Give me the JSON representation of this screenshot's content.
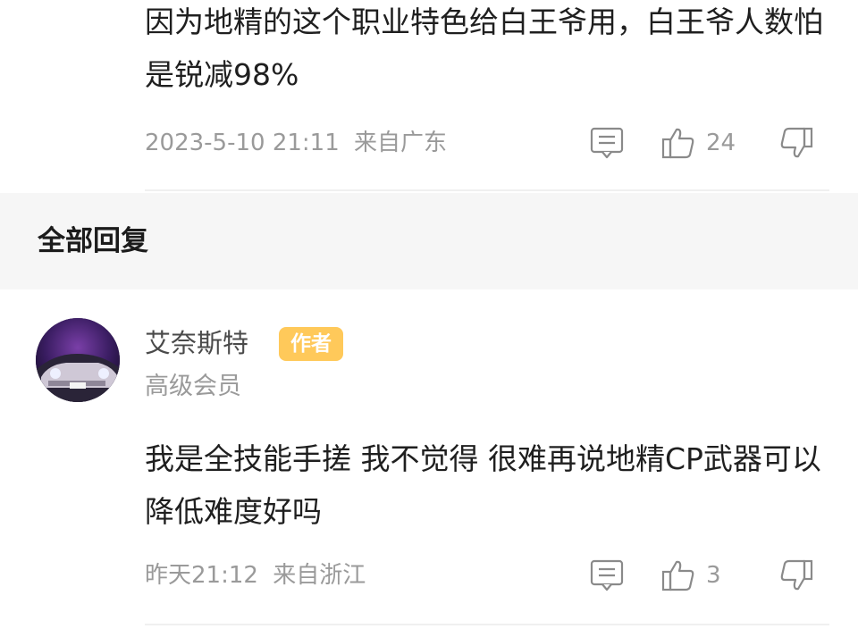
{
  "top_reply": {
    "content": "因为地精的这个职业特色给白王爷用，白王爷人数怕是锐减98%",
    "timestamp": "2023-5-10 21:11",
    "location": "来自广东",
    "like_count": "24"
  },
  "section": {
    "title": "全部回复"
  },
  "reply": {
    "username": "艾奈斯特",
    "author_badge": "作者",
    "member_level": "高级会员",
    "content": "我是全技能手搓 我不觉得 很难再说地精CP武器可以降低难度好吗",
    "timestamp": "昨天21:12",
    "location": "来自浙江",
    "like_count": "3"
  },
  "icons": {
    "comment": "comment-icon",
    "like": "thumbs-up-icon",
    "dislike": "thumbs-down-icon"
  },
  "colors": {
    "badge": "#ffc95a",
    "section_bg": "#f6f6f6",
    "meta_text": "#9a9a9a"
  }
}
